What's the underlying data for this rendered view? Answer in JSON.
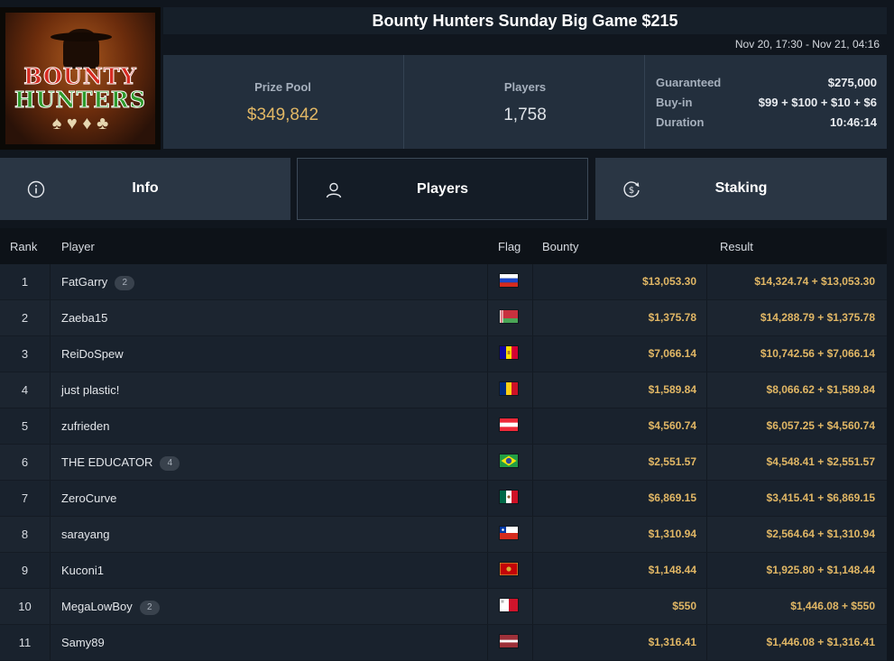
{
  "tournament": {
    "title": "Bounty Hunters Sunday Big Game $215",
    "dates": "Nov 20, 17:30 - Nov 21, 04:16",
    "logo": {
      "word1": "BOUNTY",
      "word2": "HUNTERS"
    }
  },
  "stats": {
    "prize_pool_label": "Prize Pool",
    "prize_pool_value": "$349,842",
    "players_label": "Players",
    "players_value": "1,758",
    "guaranteed_label": "Guaranteed",
    "guaranteed_value": "$275,000",
    "buyin_label": "Buy-in",
    "buyin_value": "$99 + $100 + $10 + $6",
    "duration_label": "Duration",
    "duration_value": "10:46:14"
  },
  "tabs": [
    {
      "label": "Info",
      "icon": "info-icon",
      "active": false
    },
    {
      "label": "Players",
      "icon": "user-icon",
      "active": true
    },
    {
      "label": "Staking",
      "icon": "dollar-coin-icon",
      "active": false
    }
  ],
  "table": {
    "headers": {
      "rank": "Rank",
      "player": "Player",
      "flag": "Flag",
      "bounty": "Bounty",
      "result": "Result"
    },
    "rows": [
      {
        "rank": "1",
        "player": "FatGarry",
        "badge": "2",
        "flag": "russia",
        "bounty": "$13,053.30",
        "result": "$14,324.74 + $13,053.30"
      },
      {
        "rank": "2",
        "player": "Zaeba15",
        "badge": "",
        "flag": "belarus",
        "bounty": "$1,375.78",
        "result": "$14,288.79 + $1,375.78"
      },
      {
        "rank": "3",
        "player": "ReiDoSpew",
        "badge": "",
        "flag": "andorra",
        "bounty": "$7,066.14",
        "result": "$10,742.56 + $7,066.14"
      },
      {
        "rank": "4",
        "player": "just plastic!",
        "badge": "",
        "flag": "romania",
        "bounty": "$1,589.84",
        "result": "$8,066.62 + $1,589.84"
      },
      {
        "rank": "5",
        "player": "zufrieden",
        "badge": "",
        "flag": "austria",
        "bounty": "$4,560.74",
        "result": "$6,057.25 + $4,560.74"
      },
      {
        "rank": "6",
        "player": "THE EDUCATOR",
        "badge": "4",
        "flag": "brazil",
        "bounty": "$2,551.57",
        "result": "$4,548.41 + $2,551.57"
      },
      {
        "rank": "7",
        "player": "ZeroCurve",
        "badge": "",
        "flag": "mexico",
        "bounty": "$6,869.15",
        "result": "$3,415.41 + $6,869.15"
      },
      {
        "rank": "8",
        "player": "sarayang",
        "badge": "",
        "flag": "chile",
        "bounty": "$1,310.94",
        "result": "$2,564.64 + $1,310.94"
      },
      {
        "rank": "9",
        "player": "Kuconi1",
        "badge": "",
        "flag": "montenegro",
        "bounty": "$1,148.44",
        "result": "$1,925.80 + $1,148.44"
      },
      {
        "rank": "10",
        "player": "MegaLowBoy",
        "badge": "2",
        "flag": "malta",
        "bounty": "$550",
        "result": "$1,446.08 + $550"
      },
      {
        "rank": "11",
        "player": "Samy89",
        "badge": "",
        "flag": "latvia",
        "bounty": "$1,316.41",
        "result": "$1,446.08 + $1,316.41"
      }
    ]
  },
  "colors": {
    "accent_gold": "#e1b765",
    "panel": "#232f3d",
    "background": "#10161e"
  }
}
